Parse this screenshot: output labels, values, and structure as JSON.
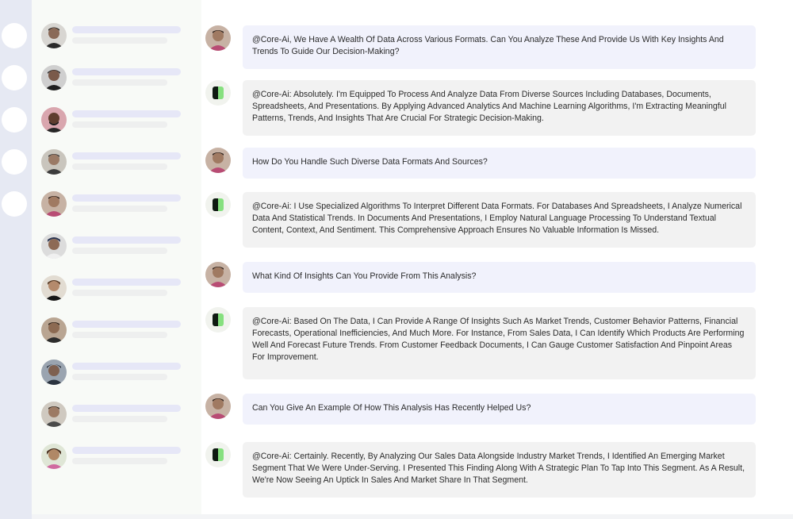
{
  "rail": {
    "items": [
      "",
      "",
      "",
      "",
      ""
    ]
  },
  "contacts": [
    {
      "avatar": "person-avatar-1"
    },
    {
      "avatar": "person-avatar-2"
    },
    {
      "avatar": "person-avatar-3"
    },
    {
      "avatar": "person-avatar-4"
    },
    {
      "avatar": "person-avatar-5"
    },
    {
      "avatar": "person-avatar-6"
    },
    {
      "avatar": "person-avatar-7"
    },
    {
      "avatar": "person-avatar-8"
    },
    {
      "avatar": "person-avatar-9"
    },
    {
      "avatar": "person-avatar-10"
    },
    {
      "avatar": "person-avatar-11"
    }
  ],
  "conversation": {
    "messages": [
      {
        "role": "user",
        "text": "@Core-Ai, We Have A Wealth Of Data Across Various Formats. Can You Analyze These And Provide Us With Key Insights And Trends To Guide Our Decision-Making?"
      },
      {
        "role": "bot",
        "text": "@Core-Ai: Absolutely. I'm Equipped To Process And Analyze Data From Diverse Sources Including Databases, Documents, Spreadsheets, And Presentations. By Applying Advanced Analytics And Machine Learning Algorithms, I'm Extracting Meaningful Patterns, Trends, And Insights That Are Crucial For Strategic Decision-Making."
      },
      {
        "role": "user",
        "text": "How Do You Handle Such Diverse Data Formats And Sources?"
      },
      {
        "role": "bot",
        "text": "@Core-Ai: I Use Specialized Algorithms To Interpret Different Data Formats. For Databases And Spreadsheets, I Analyze Numerical Data And Statistical Trends. In Documents And Presentations, I Employ Natural Language Processing To Understand Textual Content, Context, And Sentiment. This Comprehensive Approach Ensures No Valuable Information Is Missed."
      },
      {
        "role": "user",
        "text": "What Kind Of Insights Can You Provide From This Analysis?"
      },
      {
        "role": "bot",
        "text": "@Core-Ai: Based On The Data, I Can Provide A Range Of Insights Such As Market Trends, Customer Behavior Patterns, Financial Forecasts, Operational Inefficiencies, And Much More. For Instance, From Sales Data, I Can Identify Which Products Are Performing Well And Forecast Future Trends. From Customer Feedback Documents, I Can Gauge Customer Satisfaction And Pinpoint Areas For Improvement."
      },
      {
        "role": "user",
        "text": "Can You Give An Example Of How This Analysis Has Recently Helped Us?"
      },
      {
        "role": "bot",
        "text": "@Core-Ai: Certainly. Recently, By Analyzing Our Sales Data Alongside Industry Market Trends, I Identified An Emerging Market Segment That We Were Under-Serving. I Presented This Finding Along With A Strategic Plan To Tap Into This Segment. As A Result, We're Now Seeing An Uptick In Sales And Market Share In That Segment."
      }
    ]
  },
  "colors": {
    "rail": "#e6e9f3",
    "contacts_bg": "#f8faf7",
    "user_bubble": "#f1f2fc",
    "bot_bubble": "#f2f2f2",
    "bot_icon_dark": "#0f1a12",
    "bot_icon_accent": "#86e07f"
  }
}
